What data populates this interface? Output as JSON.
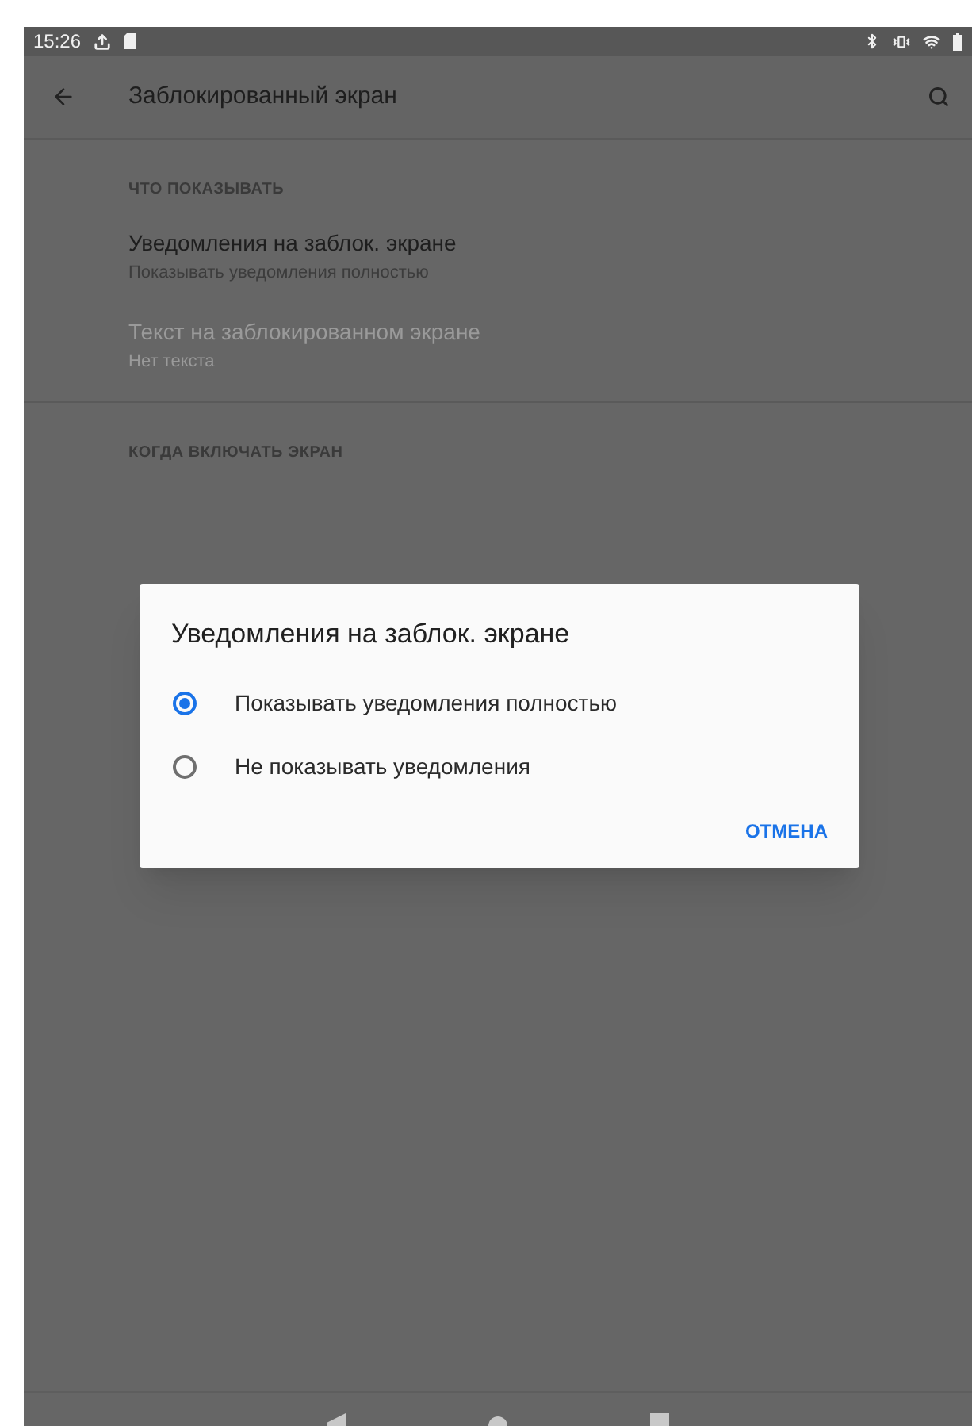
{
  "status_bar": {
    "time": "15:26"
  },
  "app_bar": {
    "title": "Заблокированный экран"
  },
  "settings": [
    {
      "kind": "header",
      "title": "ЧТО ПОКАЗЫВАТЬ"
    },
    {
      "kind": "item",
      "title": "Уведомления на заблок. экране",
      "summary": "Показывать уведомления полностью",
      "disabled": false
    },
    {
      "kind": "item",
      "title": "Текст на заблокированном экране",
      "summary": "Нет текста",
      "disabled": true
    },
    {
      "kind": "divider"
    },
    {
      "kind": "header",
      "title": "КОГДА ВКЛЮЧАТЬ ЭКРАН"
    }
  ],
  "dialog": {
    "title": "Уведомления на заблок. экране",
    "options": [
      {
        "label": "Показывать уведомления полностью",
        "selected": true
      },
      {
        "label": "Не показывать уведомления",
        "selected": false
      }
    ],
    "buttons": [
      "ОТМЕНА"
    ]
  }
}
